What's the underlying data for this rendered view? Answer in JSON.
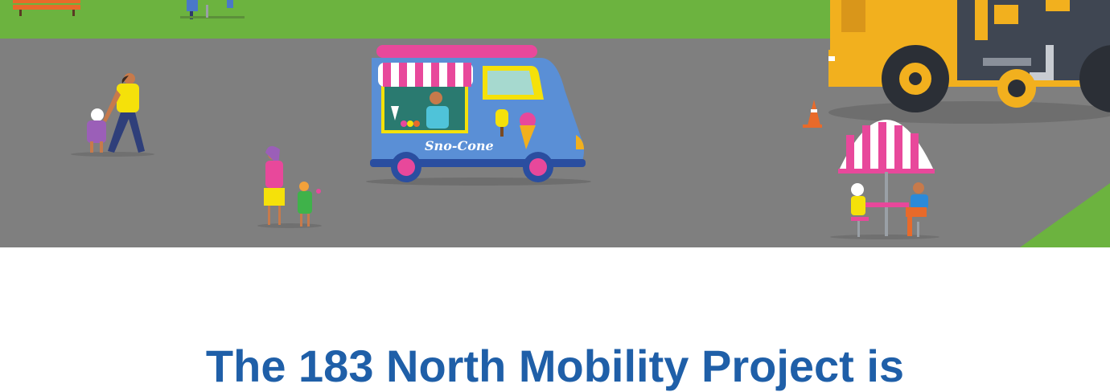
{
  "illustration": {
    "truck_sign": "Sno-Cone",
    "colors": {
      "grass": "#6cb33f",
      "road": "#7f7f7f",
      "truck": "#5a8fd6",
      "truck_roof": "#e8489b",
      "machinery": "#f2b01e",
      "headline": "#1f5fa8"
    }
  },
  "headline": "The 183 North Mobility Project is"
}
